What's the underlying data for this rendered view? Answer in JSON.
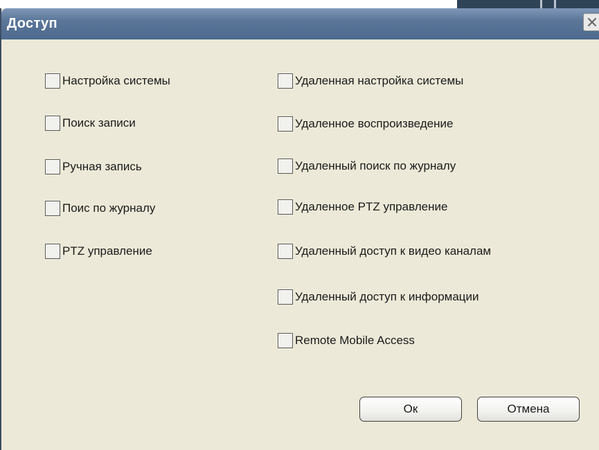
{
  "dialog": {
    "title": "Доступ",
    "close_icon": "close-icon"
  },
  "left_options": [
    {
      "label": "Настройка системы",
      "checked": false
    },
    {
      "label": "Поиск записи",
      "checked": false
    },
    {
      "label": "Ручная запись",
      "checked": false
    },
    {
      "label": "Поис по журналу",
      "checked": false
    },
    {
      "label": "PTZ управление",
      "checked": false
    }
  ],
  "right_options": [
    {
      "label": "Удаленная настройка системы",
      "checked": false
    },
    {
      "label": "Удаленное воспроизведение",
      "checked": false
    },
    {
      "label": "Удаленный поиск по журналу",
      "checked": false
    },
    {
      "label": "Удаленное PTZ управление",
      "checked": false
    },
    {
      "label": "Удаленный доступ к видео каналам",
      "checked": false
    },
    {
      "label": "Удаленный доступ к информации",
      "checked": false
    },
    {
      "label": "Remote Mobile Access",
      "checked": false
    }
  ],
  "buttons": {
    "ok_label": "Ок",
    "cancel_label": "Отмена"
  },
  "colors": {
    "titlebar": "#5a7598",
    "dialog_bg": "#ece9d8"
  }
}
